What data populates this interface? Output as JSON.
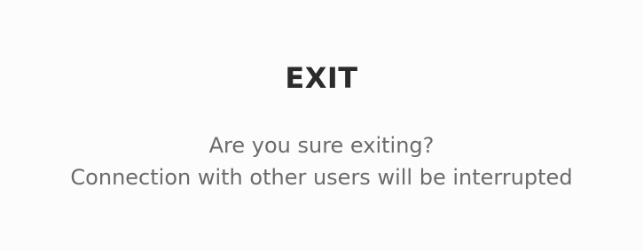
{
  "dialog": {
    "title": "EXIT",
    "message_line1": "Are you sure exiting?",
    "message_line2": "Connection with other users will be interrupted"
  }
}
